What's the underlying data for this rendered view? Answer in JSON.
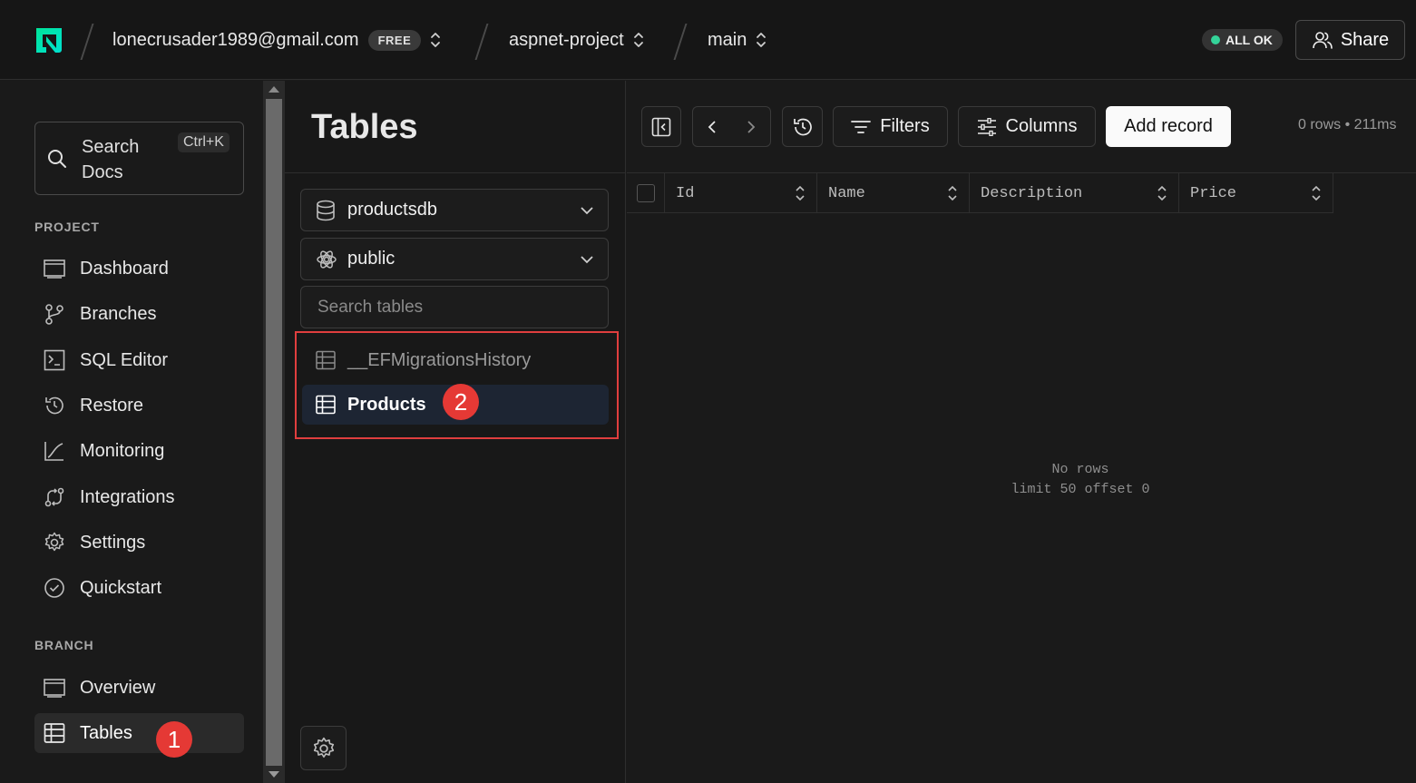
{
  "topbar": {
    "account_email": "lonecrusader1989@gmail.com",
    "plan_badge": "FREE",
    "project": "aspnet-project",
    "branch": "main",
    "status": "ALL OK",
    "share_label": "Share",
    "status_color": "#34d399"
  },
  "leftnav": {
    "search_label": "Search Docs",
    "search_shortcut": "Ctrl+K",
    "project_section": "PROJECT",
    "project_items": [
      {
        "label": "Dashboard",
        "icon": "dashboard-icon"
      },
      {
        "label": "Branches",
        "icon": "branches-icon"
      },
      {
        "label": "SQL Editor",
        "icon": "sql-editor-icon"
      },
      {
        "label": "Restore",
        "icon": "restore-icon"
      },
      {
        "label": "Monitoring",
        "icon": "monitoring-icon"
      },
      {
        "label": "Integrations",
        "icon": "integrations-icon"
      },
      {
        "label": "Settings",
        "icon": "settings-icon"
      },
      {
        "label": "Quickstart",
        "icon": "quickstart-icon"
      }
    ],
    "branch_section": "BRANCH",
    "branch_items": [
      {
        "label": "Overview",
        "icon": "overview-icon"
      },
      {
        "label": "Tables",
        "icon": "tables-icon",
        "active": true
      }
    ]
  },
  "tables_panel": {
    "title": "Tables",
    "database": "productsdb",
    "schema": "public",
    "search_placeholder": "Search tables",
    "tables": [
      {
        "label": "__EFMigrationsHistory",
        "active": false
      },
      {
        "label": "Products",
        "active": true
      }
    ]
  },
  "markers": {
    "step1": "1",
    "step2": "2",
    "color": "#e53935"
  },
  "grid": {
    "filters_label": "Filters",
    "columns_label": "Columns",
    "add_record_label": "Add record",
    "row_info": "0 rows • 211ms",
    "columns": [
      "Id",
      "Name",
      "Description",
      "Price"
    ],
    "empty_line1": "No rows",
    "empty_line2": "limit 50 offset 0"
  }
}
